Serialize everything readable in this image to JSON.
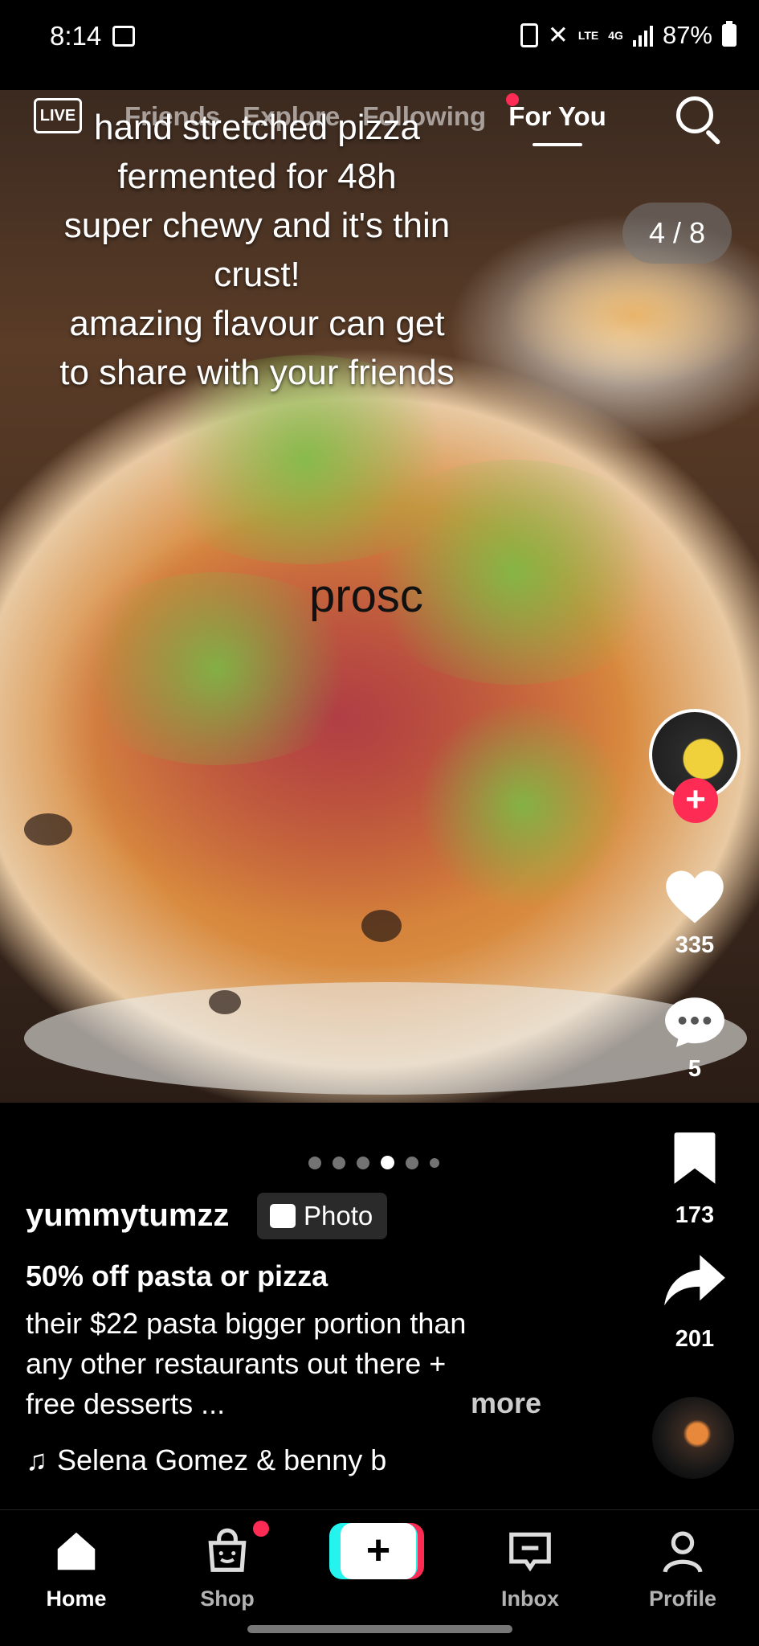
{
  "status_bar": {
    "time": "8:14",
    "network": "4G",
    "lte": "LTE",
    "battery": "87%"
  },
  "top_nav": {
    "live_label": "LIVE",
    "tabs": [
      "Friends",
      "Explore",
      "Following",
      "For You"
    ],
    "active_tab": "For You"
  },
  "post": {
    "photo_counter": "4 / 8",
    "caption_overlay": "hand stretched pizza\nfermented for 48h\nsuper chewy and it's thin\ncrust!\namazing flavour can get\nto share with your friends",
    "sticker_text": "prosc",
    "username": "yummytumzz",
    "badge": "Photo",
    "title": "50% off pasta or pizza",
    "description": "their $22 pasta bigger portion than\nany other restaurants out there +\nfree desserts ...",
    "more_label": "more",
    "music": "Selena Gomez & benny b",
    "current_page": 4,
    "total_dots": 6
  },
  "actions": {
    "likes": "335",
    "comments": "5",
    "bookmarks": "173",
    "shares": "201"
  },
  "bottom_nav": {
    "home": "Home",
    "shop": "Shop",
    "create": "+",
    "inbox": "Inbox",
    "profile": "Profile"
  },
  "colors": {
    "accent": "#fe2c55",
    "create_left": "#25f4ee"
  }
}
